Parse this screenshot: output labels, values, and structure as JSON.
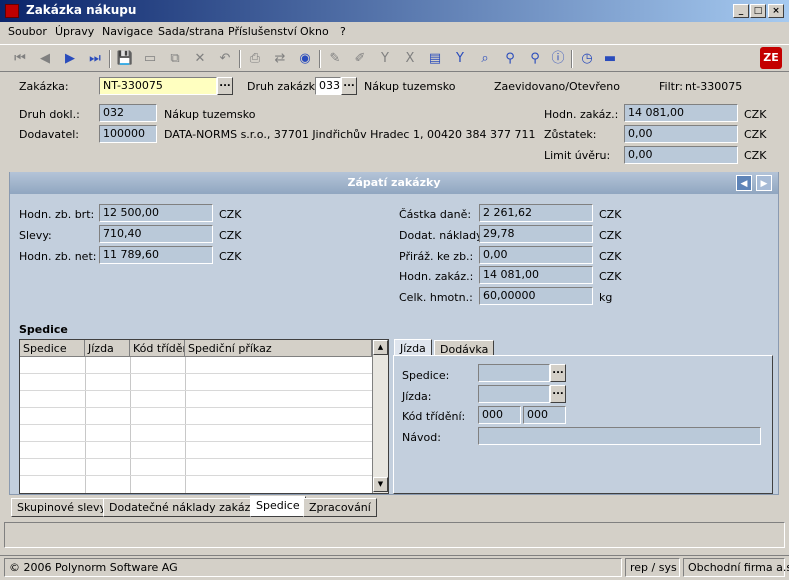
{
  "window": {
    "title": "Zakázka nákupu",
    "buttons": {
      "minimize": "_",
      "maximize": "□",
      "close": "×"
    }
  },
  "menu": [
    "Soubor",
    "Úpravy",
    "Navigace",
    "Sada/strana",
    "Příslušenství",
    "Okno",
    "?"
  ],
  "toolbar": {
    "icons": [
      "first-record-icon",
      "prev-record-icon",
      "next-record-icon",
      "last-record-icon",
      "save-icon",
      "new-icon",
      "copy-icon",
      "delete-icon",
      "undo-icon",
      "print-icon",
      "export-icon",
      "attachment-icon",
      "edit-icon",
      "pencil-icon",
      "filter-icon",
      "clear-filter-icon",
      "clipboard-icon",
      "check-filter-icon",
      "find-icon",
      "zoom-icon",
      "zoom-out-icon",
      "info-icon",
      "clock-icon",
      "truck-icon"
    ],
    "logo_text": "ZE"
  },
  "header": {
    "zakazka_label": "Zakázka:",
    "zakazka_value": "NT-330075",
    "druh_zakazk_label": "Druh zakázk:",
    "druh_zakazk_value": "033",
    "druh_zakazk_text": "Nákup tuzemsko",
    "status": "Zaevidovano/Otevřeno",
    "filtr_label": "Filtr:",
    "filtr_value": "nt-330075",
    "druh_dokl_label": "Druh dokl.:",
    "druh_dokl_value": "032",
    "druh_dokl_text": "Nákup tuzemsko",
    "dodavatel_label": "Dodavatel:",
    "dodavatel_value": "100000",
    "dodavatel_text": "DATA-NORMS s.r.o., 37701 Jindřichův Hradec 1, 00420 384 377 711",
    "hodn_zakaz_label": "Hodn. zakáz.:",
    "hodn_zakaz_value": "14 081,00",
    "zustatek_label": "Zůstatek:",
    "zustatek_value": "0,00",
    "limit_label": "Limit úvěru:",
    "limit_value": "0,00",
    "currency": "CZK"
  },
  "zapati": {
    "title": "Zápatí zakázky",
    "left": [
      {
        "label": "Hodn. zb. brt:",
        "value": "12 500,00",
        "unit": "CZK"
      },
      {
        "label": "Slevy:",
        "value": "710,40",
        "unit": "CZK"
      },
      {
        "label": "Hodn. zb. net:",
        "value": "11 789,60",
        "unit": "CZK"
      }
    ],
    "right": [
      {
        "label": "Částka daně:",
        "value": "2 261,62",
        "unit": "CZK"
      },
      {
        "label": "Dodat. náklady:",
        "value": "29,78",
        "unit": "CZK"
      },
      {
        "label": "Přiráž. ke zb.:",
        "value": "0,00",
        "unit": "CZK"
      },
      {
        "label": "Hodn. zakáz.:",
        "value": "14 081,00",
        "unit": "CZK"
      },
      {
        "label": "Celk. hmotn.:",
        "value": "60,00000",
        "unit": "kg"
      }
    ]
  },
  "spedice": {
    "section_label": "Spedice",
    "columns": [
      "Spedice",
      "Jízda",
      "Kód třídění",
      "Spediční příkaz"
    ]
  },
  "detail_tabs": [
    "Jízda",
    "Dodávka"
  ],
  "detail": {
    "spedice_label": "Spedice:",
    "jizda_label": "Jízda:",
    "kod_label": "Kód třídění:",
    "kod_value1": "000",
    "kod_value2": "000",
    "navod_label": "Návod:"
  },
  "bottom_tabs": [
    "Skupinové slevy",
    "Dodatečné náklady zakázky",
    "Spedice",
    "Zpracování"
  ],
  "statusbar": {
    "copyright": "© 2006 Polynorm Software AG",
    "user": "rep / sys",
    "company": "Obchodní firma a.s."
  }
}
